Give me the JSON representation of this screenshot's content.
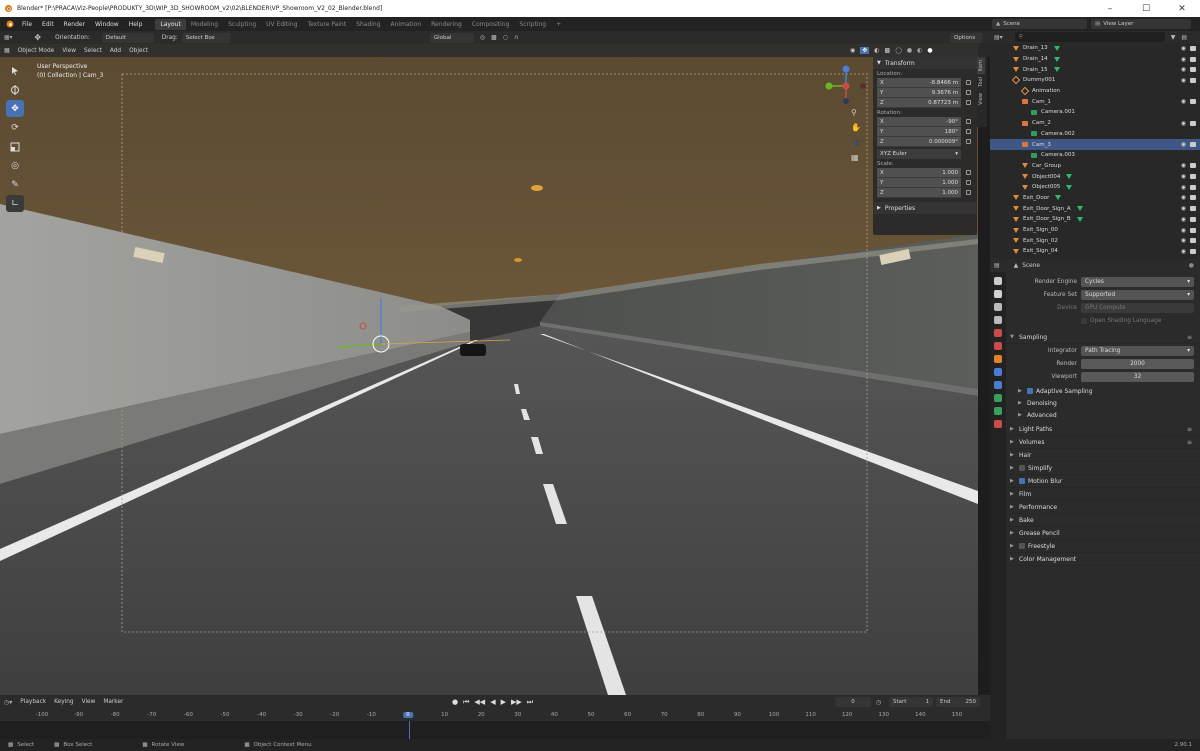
{
  "window": {
    "title": "Blender* [P:\\PRACA\\Viz-People\\PRODUKTY_3D\\WIP_3D_SHOWROOM_v2\\02\\BLENDER\\VP_Showroom_V2_02_Blender.blend]"
  },
  "menu": [
    "File",
    "Edit",
    "Render",
    "Window",
    "Help"
  ],
  "workspaces": [
    {
      "label": "Layout",
      "active": true
    },
    {
      "label": "Modeling"
    },
    {
      "label": "Sculpting"
    },
    {
      "label": "UV Editing"
    },
    {
      "label": "Texture Paint"
    },
    {
      "label": "Shading"
    },
    {
      "label": "Animation"
    },
    {
      "label": "Rendering"
    },
    {
      "label": "Compositing"
    },
    {
      "label": "Scripting"
    }
  ],
  "add_workspace": "+",
  "scene": {
    "name": "Scene",
    "view_layer": "View Layer"
  },
  "tool_header": {
    "orientation_label": "Orientation:",
    "orientation_value": "Default",
    "drag_label": "Drag:",
    "drag_value": "Select Box",
    "transform_space": "Global",
    "options": "Options"
  },
  "viewport_header": {
    "mode": "Object Mode",
    "items": [
      "View",
      "Select",
      "Add",
      "Object"
    ]
  },
  "viewport": {
    "perspective": "User Perspective",
    "collection": "(0) Collection | Cam_3"
  },
  "npanel": {
    "transform_title": "Transform",
    "location_label": "Location:",
    "location": [
      {
        "axis": "X",
        "value": "-8.8466 m"
      },
      {
        "axis": "Y",
        "value": "9.3676 m"
      },
      {
        "axis": "Z",
        "value": "0.87723 m"
      }
    ],
    "rotation_label": "Rotation:",
    "rotation": [
      {
        "axis": "X",
        "value": "-90°"
      },
      {
        "axis": "Y",
        "value": "180°"
      },
      {
        "axis": "Z",
        "value": "0.000009°"
      }
    ],
    "rotation_mode": "XYZ Euler",
    "scale_label": "Scale:",
    "scale": [
      {
        "axis": "X",
        "value": "1.000"
      },
      {
        "axis": "Y",
        "value": "1.000"
      },
      {
        "axis": "Z",
        "value": "1.000"
      }
    ],
    "properties_title": "Properties",
    "tabs": [
      "Item",
      "Tool",
      "View"
    ]
  },
  "outliner": {
    "search_placeholder": "",
    "rows": [
      {
        "name": "Drain_13",
        "indent": 1,
        "type": "mesh",
        "extra": "green"
      },
      {
        "name": "Drain_14",
        "indent": 1,
        "type": "mesh",
        "extra": "green"
      },
      {
        "name": "Drain_15",
        "indent": 1,
        "type": "mesh",
        "extra": "green"
      },
      {
        "name": "Dummy001",
        "indent": 1,
        "type": "empty"
      },
      {
        "name": "Animation",
        "indent": 2,
        "type": "anim"
      },
      {
        "name": "Cam_1",
        "indent": 2,
        "type": "cam"
      },
      {
        "name": "Camera.001",
        "indent": 3,
        "type": "camdata"
      },
      {
        "name": "Cam_2",
        "indent": 2,
        "type": "cam"
      },
      {
        "name": "Camera.002",
        "indent": 3,
        "type": "camdata"
      },
      {
        "name": "Cam_3",
        "indent": 2,
        "type": "cam",
        "selected": true
      },
      {
        "name": "Camera.003",
        "indent": 3,
        "type": "camdata"
      },
      {
        "name": "Car_Group",
        "indent": 2,
        "type": "mesh"
      },
      {
        "name": "Object004",
        "indent": 2,
        "type": "mesh",
        "extra": "green"
      },
      {
        "name": "Object005",
        "indent": 2,
        "type": "mesh",
        "extra": "green"
      },
      {
        "name": "Exit_Door",
        "indent": 1,
        "type": "mesh",
        "extra": "green"
      },
      {
        "name": "Exit_Door_Sign_A",
        "indent": 1,
        "type": "mesh",
        "extra": "green"
      },
      {
        "name": "Exit_Door_Sign_B",
        "indent": 1,
        "type": "mesh",
        "extra": "green"
      },
      {
        "name": "Exit_Sign_00",
        "indent": 1,
        "type": "mesh"
      },
      {
        "name": "Exit_Sign_02",
        "indent": 1,
        "type": "mesh"
      },
      {
        "name": "Exit_Sign_04",
        "indent": 1,
        "type": "mesh"
      }
    ]
  },
  "properties": {
    "context": "Scene",
    "render_engine_label": "Render Engine",
    "render_engine": "Cycles",
    "feature_set_label": "Feature Set",
    "feature_set": "Supported",
    "device_label": "Device",
    "device": "GPU Compute",
    "osl_label": "Open Shading Language",
    "sampling_title": "Sampling",
    "integrator_label": "Integrator",
    "integrator": "Path Tracing",
    "render_label": "Render",
    "render_samples": "2000",
    "viewport_label": "Viewport",
    "viewport_samples": "32",
    "subsections": [
      {
        "label": "Adaptive Sampling",
        "checkbox": true,
        "checked": true
      },
      {
        "label": "Denoising"
      },
      {
        "label": "Advanced"
      }
    ],
    "panels": [
      {
        "label": "Light Paths"
      },
      {
        "label": "Volumes"
      },
      {
        "label": "Hair"
      },
      {
        "label": "Simplify",
        "checkbox": true,
        "checked": false
      },
      {
        "label": "Motion Blur",
        "checkbox": true,
        "checked": true
      },
      {
        "label": "Film"
      },
      {
        "label": "Performance"
      },
      {
        "label": "Bake"
      },
      {
        "label": "Grease Pencil"
      },
      {
        "label": "Freestyle",
        "checkbox": true,
        "checked": false
      },
      {
        "label": "Color Management"
      }
    ]
  },
  "timeline": {
    "menus": [
      "Playback",
      "Keying",
      "View",
      "Marker"
    ],
    "current_frame": "0",
    "start_label": "Start",
    "start": "1",
    "end_label": "End",
    "end": "250",
    "ruler": [
      "-100",
      "-90",
      "-80",
      "-70",
      "-60",
      "-50",
      "-40",
      "-30",
      "-20",
      "-10",
      "0",
      "10",
      "20",
      "30",
      "40",
      "50",
      "60",
      "70",
      "80",
      "90",
      "100",
      "110",
      "120",
      "130",
      "140",
      "150"
    ],
    "playhead": "0"
  },
  "statusbar": {
    "select": "Select",
    "box_select": "Box Select",
    "rotate_view": "Rotate View",
    "context_menu": "Object Context Menu",
    "version": "2.90.1"
  }
}
